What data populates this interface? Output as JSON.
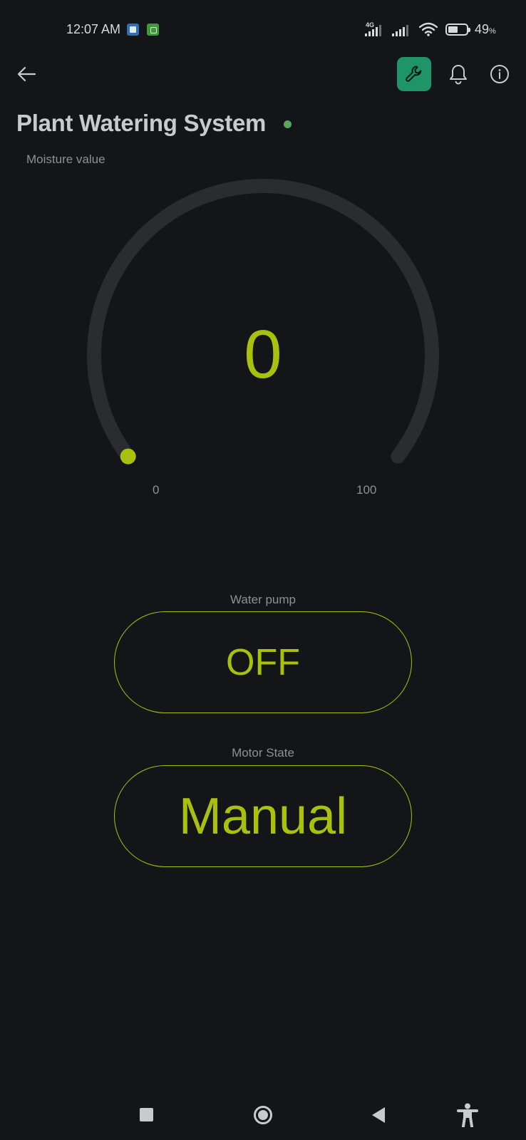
{
  "status_bar": {
    "time": "12:07 AM",
    "network_type": "4G",
    "battery_percent": "49",
    "battery_unit": "%",
    "notification_icons": [
      "outlook-icon",
      "green-app-icon"
    ]
  },
  "header": {
    "back_icon": "arrow-left-icon",
    "actions": [
      "wrench-icon",
      "bell-icon",
      "info-icon"
    ],
    "accent_color": "#1f9468"
  },
  "device": {
    "title": "Plant Watering System",
    "online": true,
    "status_color": "#57a65c"
  },
  "gauge": {
    "label": "Moisture value",
    "value": "0",
    "min": "0",
    "max": "100",
    "fraction": 0,
    "accent_color": "#a9c10c"
  },
  "water_pump": {
    "label": "Water pump",
    "state": "OFF"
  },
  "motor_state": {
    "label": "Motor State",
    "state": "Manual"
  },
  "nav_bar": {
    "buttons": [
      "recents-square-icon",
      "home-circle-icon",
      "back-triangle-icon",
      "accessibility-icon"
    ]
  }
}
